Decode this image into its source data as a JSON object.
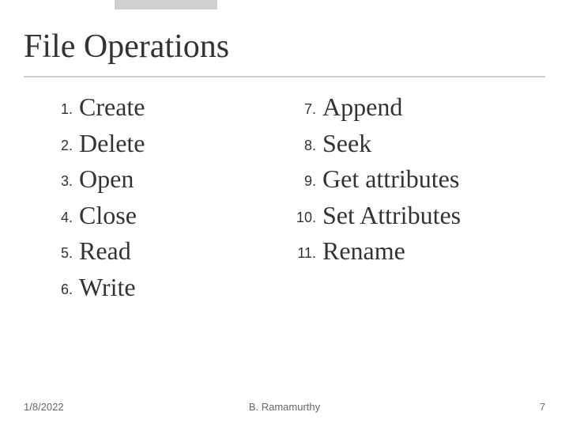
{
  "title": "File Operations",
  "left_items": [
    {
      "n": "1.",
      "t": "Create"
    },
    {
      "n": "2.",
      "t": "Delete"
    },
    {
      "n": "3.",
      "t": "Open"
    },
    {
      "n": "4.",
      "t": "Close"
    },
    {
      "n": "5.",
      "t": "Read"
    },
    {
      "n": "6.",
      "t": "Write"
    }
  ],
  "right_items": [
    {
      "n": "7.",
      "t": "Append"
    },
    {
      "n": "8.",
      "t": "Seek"
    },
    {
      "n": "9.",
      "t": "Get attributes"
    },
    {
      "n": "10.",
      "t": "Set Attributes"
    },
    {
      "n": "11.",
      "t": "Rename"
    }
  ],
  "footer": {
    "date": "1/8/2022",
    "author": "B. Ramamurthy",
    "page": "7"
  }
}
